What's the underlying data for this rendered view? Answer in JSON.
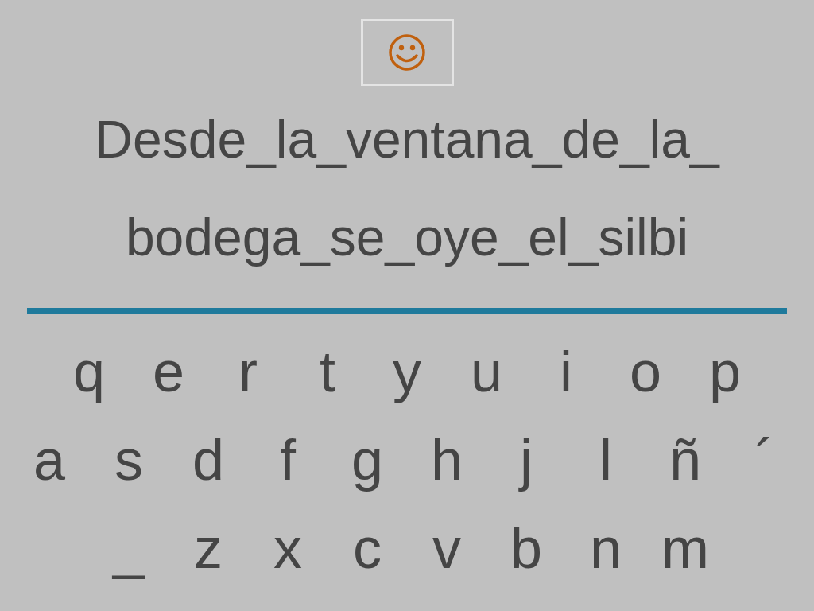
{
  "sentence_lines": [
    "Desde_la_ventana_de_la_",
    "bodega_se_oye_el_silbi"
  ],
  "keyboard_rows": [
    [
      "q",
      "e",
      "r",
      "t",
      "y",
      "u",
      "i",
      "o",
      "p"
    ],
    [
      "a",
      "s",
      "d",
      "f",
      "g",
      "h",
      "j",
      "l",
      "ñ",
      "´"
    ],
    [
      "_",
      "z",
      "x",
      "c",
      "v",
      "b",
      "n",
      "m"
    ]
  ]
}
